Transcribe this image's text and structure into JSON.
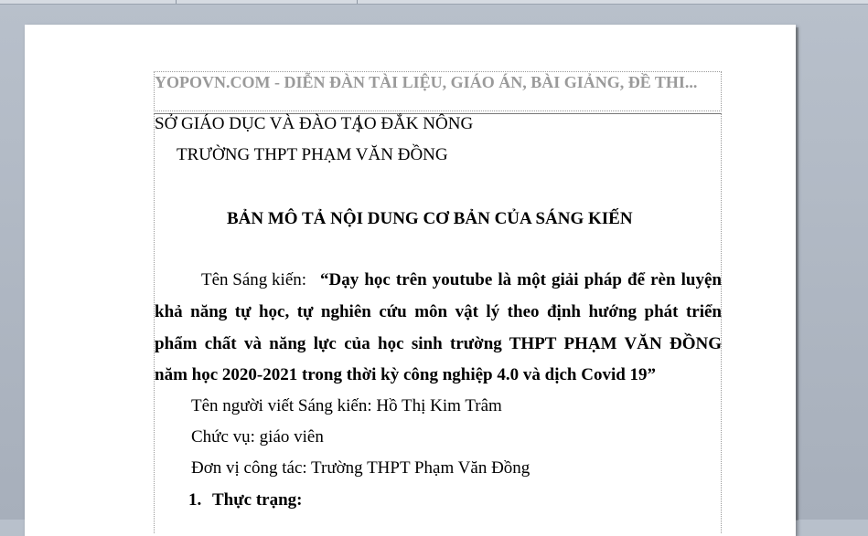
{
  "header": {
    "text": "YOPOVN.COM - DIỄN ĐÀN TÀI LIỆU, GIÁO ÁN, BÀI GIẢNG, ĐỀ THI..."
  },
  "document": {
    "department": "SỞ GIÁO DỤC VÀ ĐÀO TẠO ĐẮK NÔNG",
    "school": "TRƯỜNG THPT PHẠM VĂN ĐỒNG",
    "title": "BẢN MÔ TẢ NỘI DUNG CƠ BẢN CỦA SÁNG KIẾN",
    "initiative_label": "Tên Sáng kiến: ",
    "initiative_lines": [
      "“Dạy học trên youtube là một giải pháp để rèn luyện",
      "khả năng tự học, tự nghiên cứu môn vật lý theo định hướng phát triển",
      "phẩm chất và  năng lực của học sinh trường THPT PHẠM VĂN ĐỒNG",
      "năm học 2020-2021 trong thời kỳ công nghiệp 4.0 và dịch Covid 19”"
    ],
    "author": "Tên người viết Sáng kiến: Hồ Thị Kim Trâm",
    "position": "Chức vụ: giáo viên",
    "unit": "Đơn vị công tác: Trường THPT Phạm Văn Đồng",
    "section_number": "1.",
    "section_title": "Thực trạng:"
  }
}
